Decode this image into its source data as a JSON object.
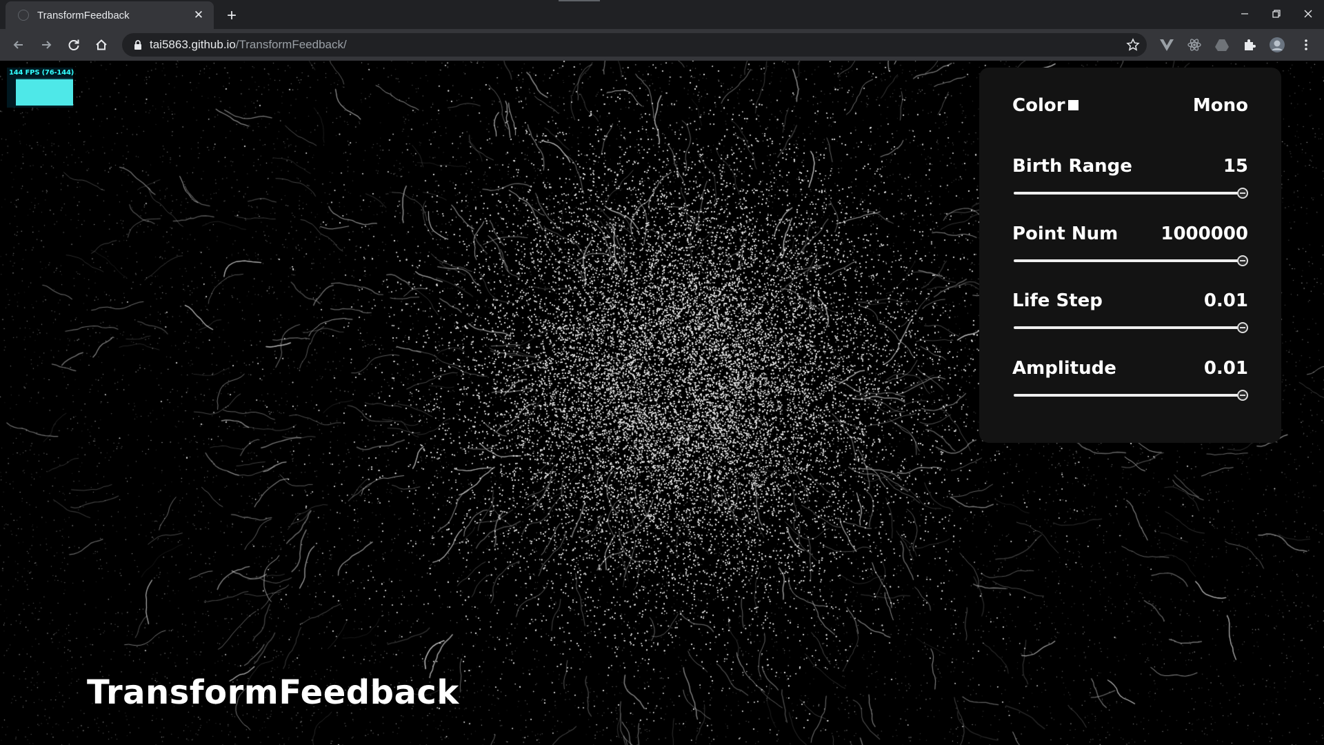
{
  "browser": {
    "tab_title": "TransformFeedback",
    "url_host": "tai5863.github.io",
    "url_path": "/TransformFeedback/"
  },
  "stats": {
    "fps_text": "144 FPS (76-144)"
  },
  "page": {
    "title": "TransformFeedback"
  },
  "controls": {
    "color": {
      "label": "Color",
      "value": "Mono",
      "swatch": "#ffffff"
    },
    "sliders": [
      {
        "label": "Birth Range",
        "value": "15",
        "level": 1.0
      },
      {
        "label": "Point Num",
        "value": "1000000",
        "level": 1.0
      },
      {
        "label": "Life Step",
        "value": "0.01",
        "level": 1.0
      },
      {
        "label": "Amplitude",
        "value": "0.01",
        "level": 1.0
      }
    ]
  },
  "colors": {
    "chrome_dark": "#202124",
    "chrome_toolbar": "#35363a",
    "panel_bg": "#131313",
    "fps_accent": "#4ee8e8"
  }
}
